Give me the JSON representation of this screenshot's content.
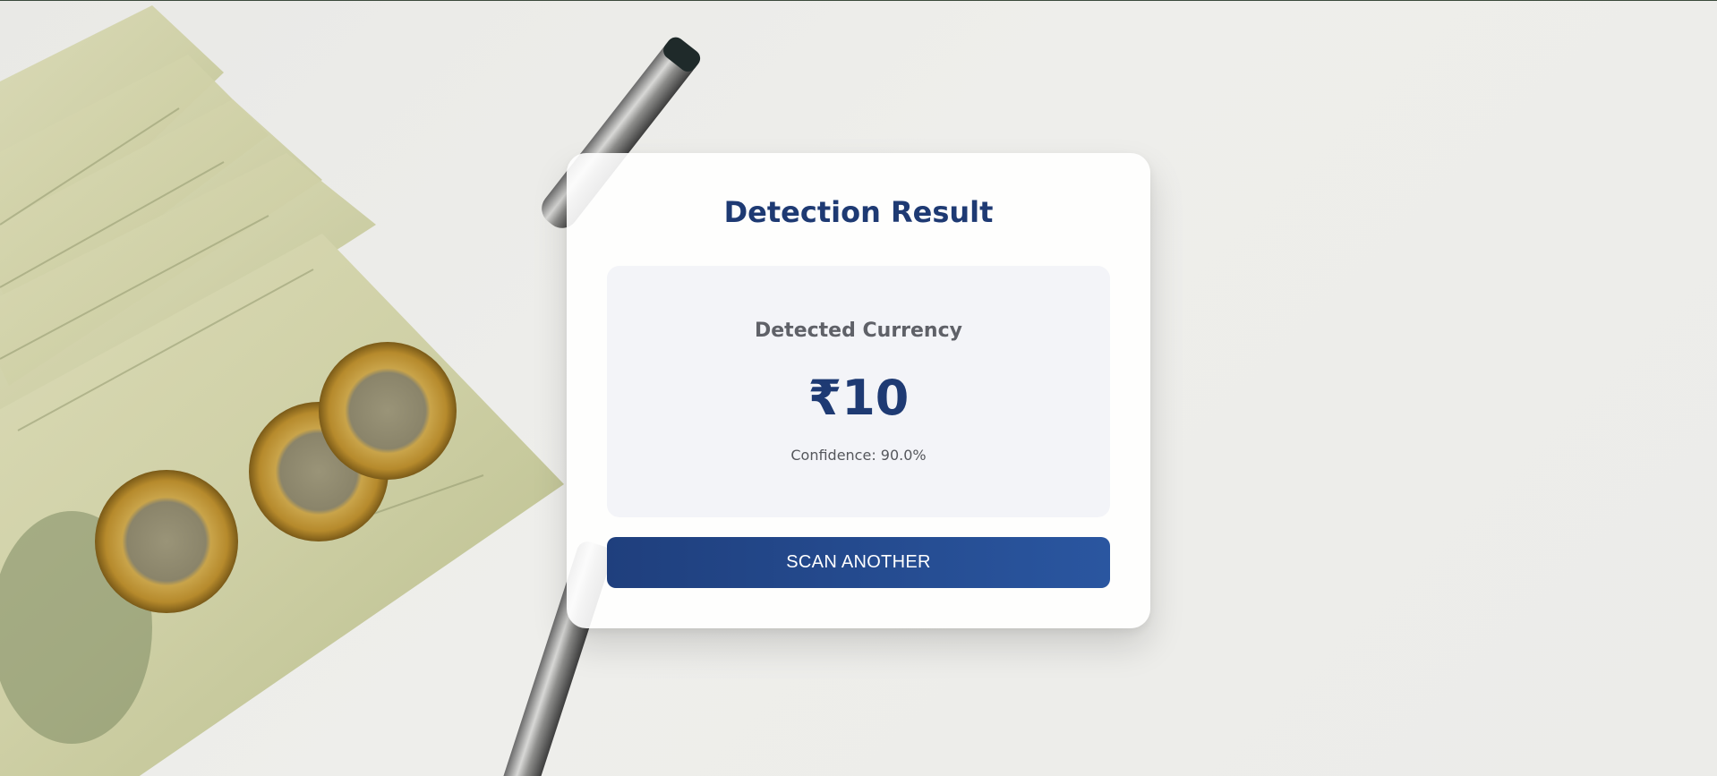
{
  "result_card": {
    "title": "Detection Result",
    "label": "Detected Currency",
    "value": "₹10",
    "confidence": "Confidence: 90.0%",
    "button_label": "SCAN ANOTHER"
  },
  "colors": {
    "accent": "#1e3a73",
    "button_start": "#1f3f7d",
    "button_end": "#2a56a0",
    "result_box_bg": "#f3f4f8"
  }
}
